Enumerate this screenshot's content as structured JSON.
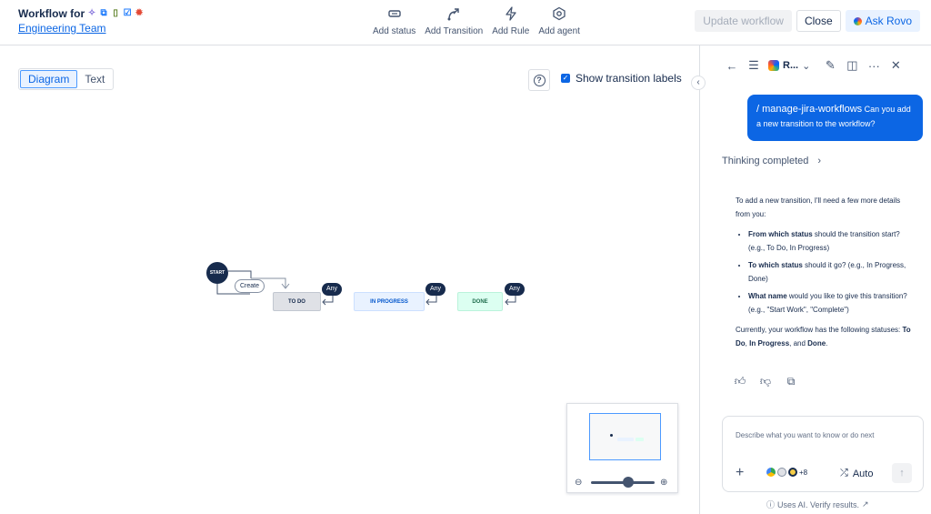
{
  "header": {
    "title": "Workflow for",
    "project_link": "Engineering Team",
    "tools": [
      {
        "label": "Add status",
        "icon": "status-icon"
      },
      {
        "label": "Add Transition",
        "icon": "transition-icon"
      },
      {
        "label": "Add Rule",
        "icon": "rule-icon"
      },
      {
        "label": "Add agent",
        "icon": "agent-icon"
      }
    ],
    "update_button": "Update workflow",
    "close_button": "Close",
    "ask_rovo_button": "Ask Rovo"
  },
  "canvas": {
    "view_tabs": [
      "Diagram",
      "Text"
    ],
    "active_view": "Diagram",
    "show_labels": "Show transition labels",
    "show_labels_checked": true,
    "diagram": {
      "start": "START",
      "create": "Create",
      "statuses": [
        "TO DO",
        "IN PROGRESS",
        "DONE"
      ],
      "any": [
        "Any",
        "Any",
        "Any"
      ]
    },
    "zoom_level": 0.5
  },
  "panel": {
    "agent_name": "R...",
    "user_message": {
      "command": "/ manage-jira-workflows",
      "text": "Can you add a new transition to the workflow?"
    },
    "thinking": "Thinking completed",
    "answer": {
      "intro": "To add a new transition, I'll need a few more details from you:",
      "bullets": [
        {
          "bold": "From which status",
          "text": " should the transition start? (e.g., To Do, In Progress)"
        },
        {
          "bold": "To which status",
          "text": " should it go? (e.g., In Progress, Done)"
        },
        {
          "bold": "What name",
          "text": " would you like to give this transition? (e.g., \"Start Work\", \"Complete\")"
        }
      ],
      "outro_pre": "Currently, your workflow has the following statuses: ",
      "status_1": "To Do",
      "sep_1": ", ",
      "status_2": "In Progress",
      "sep_2": ", and ",
      "status_3": "Done",
      "end": "."
    },
    "compose_placeholder": "Describe what you want to know or do next",
    "more_tools": "+8",
    "mode": "Auto",
    "disclaimer": "Uses AI. Verify results."
  }
}
